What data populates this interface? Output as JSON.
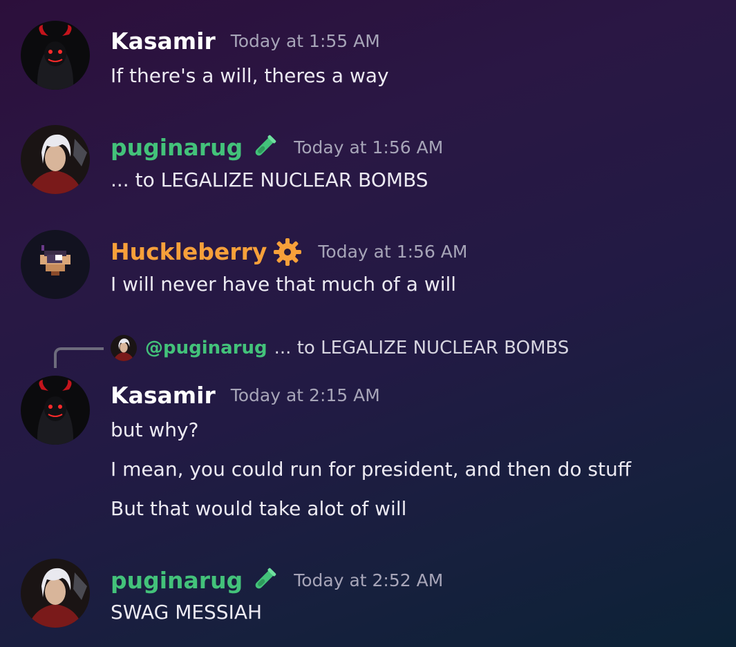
{
  "messages": [
    {
      "author": "Kasamir",
      "author_color": "#ffffff",
      "timestamp": "Today at 1:55 AM",
      "avatar": "red-horned-hood-avatar",
      "lines": [
        "If there's a will, theres a way"
      ]
    },
    {
      "author": "puginarug",
      "author_color": "#43c27a",
      "role_icon": "green-test-tube-icon",
      "timestamp": "Today at 1:56 AM",
      "avatar": "white-haired-character-avatar",
      "lines": [
        "... to LEGALIZE NUCLEAR BOMBS"
      ]
    },
    {
      "author": "Huckleberry",
      "author_color": "#f7a03a",
      "role_icon": "orange-gear-icon",
      "timestamp": "Today at 1:56 AM",
      "avatar": "pixel-eye-avatar",
      "lines": [
        "I will never have that much of a will"
      ]
    },
    {
      "reply": {
        "mention": "@puginarug",
        "text": "... to LEGALIZE NUCLEAR BOMBS"
      },
      "author": "Kasamir",
      "author_color": "#ffffff",
      "timestamp": "Today at 2:15 AM",
      "avatar": "red-horned-hood-avatar",
      "lines": [
        "but why?",
        "I mean, you could run for president, and then do stuff",
        "But that would take alot of will"
      ]
    },
    {
      "author": "puginarug",
      "author_color": "#43c27a",
      "role_icon": "green-test-tube-icon",
      "timestamp": "Today at 2:52 AM",
      "avatar": "white-haired-character-avatar",
      "lines": [
        "SWAG MESSIAH"
      ]
    }
  ]
}
